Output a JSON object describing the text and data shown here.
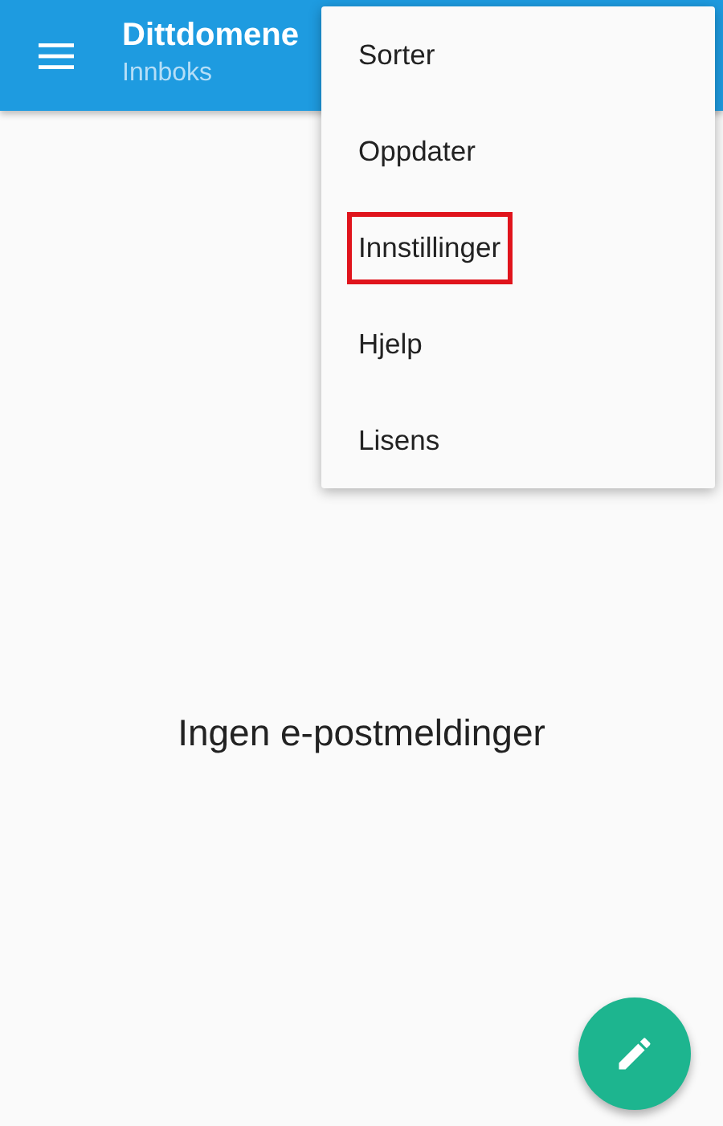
{
  "app_bar": {
    "title": "Dittdomene",
    "subtitle": "Innboks"
  },
  "menu": {
    "items": [
      {
        "label": "Sorter",
        "highlighted": false
      },
      {
        "label": "Oppdater",
        "highlighted": false
      },
      {
        "label": "Innstillinger",
        "highlighted": true
      },
      {
        "label": "Hjelp",
        "highlighted": false
      },
      {
        "label": "Lisens",
        "highlighted": false
      }
    ]
  },
  "empty_message": "Ingen e-postmeldinger"
}
